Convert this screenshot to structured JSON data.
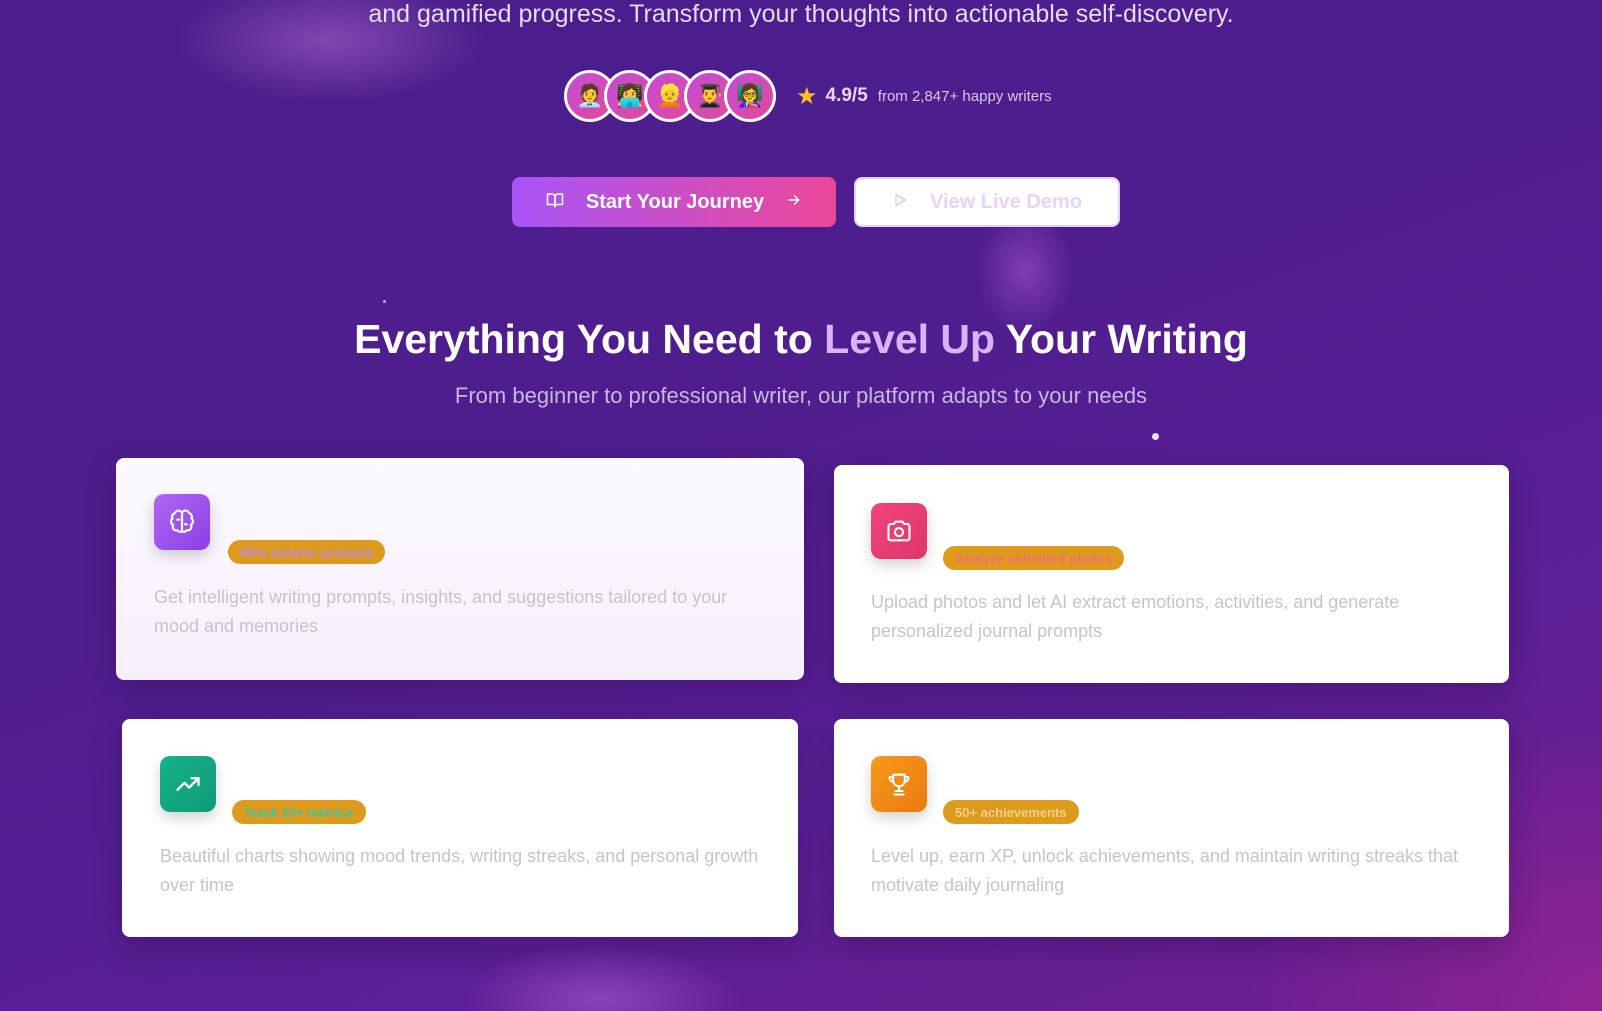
{
  "hero": {
    "subtitle": "and gamified progress. Transform your thoughts into actionable self-discovery."
  },
  "social_proof": {
    "avatars": [
      "🧑‍💼",
      "👩‍💻",
      "👱",
      "👨‍🎓",
      "👩‍🏫"
    ],
    "rating": "4.9/5",
    "caption": "from 2,847+ happy writers",
    "star_color": "#fbbf24"
  },
  "cta": {
    "primary_label": "Start Your Journey",
    "secondary_label": "View Live Demo"
  },
  "features": {
    "title_before": "Everything You Need to ",
    "title_accent": "Level Up",
    "title_after": " Your Writing",
    "subtitle": "From beginner to professional writer, our platform adapts to your needs",
    "cards": [
      {
        "icon": "brain-icon",
        "badge": "95% smarter prompts",
        "badge_text_color": "#c48bd6",
        "description": "Get intelligent writing prompts, insights, and suggestions tailored to your mood and memories"
      },
      {
        "icon": "camera-icon",
        "badge": "Analyze unlimited photos",
        "badge_text_color": "#f07070",
        "description": "Upload photos and let AI extract emotions, activities, and generate personalized journal prompts"
      },
      {
        "icon": "trending-up-icon",
        "badge": "Track 20+ metrics",
        "badge_text_color": "#3fc4a0",
        "description": "Beautiful charts showing mood trends, writing streaks, and personal growth over time"
      },
      {
        "icon": "trophy-icon",
        "badge": "50+ achievements",
        "badge_text_color": "#f2d089",
        "description": "Level up, earn XP, unlock achievements, and maintain writing streaks that motivate daily journaling"
      }
    ]
  },
  "colors": {
    "primary_gradient": [
      "#a855f7",
      "#ec4899"
    ],
    "accent": "#d8b4fe",
    "background": "#4f1d8e"
  }
}
